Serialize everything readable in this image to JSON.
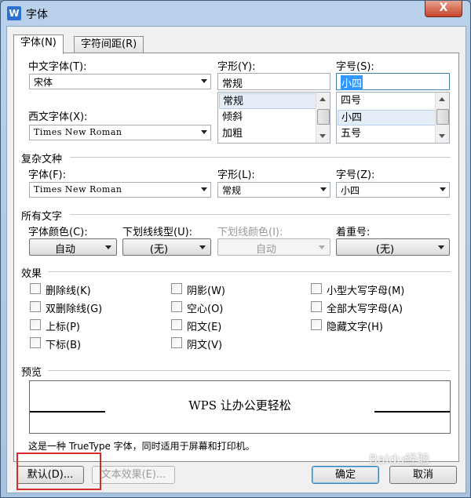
{
  "window": {
    "title": "字体",
    "app_icon": "W",
    "close_symbol": "X"
  },
  "tabs": [
    {
      "label": "字体(N)"
    },
    {
      "label": "字符间距(R)"
    }
  ],
  "chinese_font": {
    "label": "中文字体(T):",
    "value": "宋体"
  },
  "western_font": {
    "label": "西文字体(X):",
    "value": "Times New Roman"
  },
  "style": {
    "label": "字形(Y):",
    "value": "常规",
    "items": [
      "常规",
      "倾斜",
      "加粗"
    ],
    "selected": "常规"
  },
  "size": {
    "label": "字号(S):",
    "value": "小四",
    "items": [
      "四号",
      "小四",
      "五号"
    ],
    "selected": "小四"
  },
  "complex": {
    "section": "复杂文种",
    "font_label": "字体(F):",
    "font_value": "Times New Roman",
    "style_label": "字形(L):",
    "style_value": "常规",
    "size_label": "字号(Z):",
    "size_value": "小四"
  },
  "all_text": {
    "section": "所有文字",
    "color_label": "字体颜色(C):",
    "color_value": "自动",
    "underline_label": "下划线线型(U):",
    "underline_value": "(无)",
    "underline_color_label": "下划线颜色(I):",
    "underline_color_value": "自动",
    "emphasis_label": "着重号:",
    "emphasis_value": "(无)"
  },
  "effects": {
    "section": "效果",
    "items": [
      "删除线(K)",
      "双删除线(G)",
      "上标(P)",
      "下标(B)",
      "阴影(W)",
      "空心(O)",
      "阳文(E)",
      "阴文(V)",
      "小型大写字母(M)",
      "全部大写字母(A)",
      "隐藏文字(H)"
    ]
  },
  "preview": {
    "section": "预览",
    "sample": "WPS 让办公更轻松",
    "note": "这是一种 TrueType 字体，同时适用于屏幕和打印机。"
  },
  "buttons": {
    "default": "默认(D)...",
    "text_effects": "文本效果(E)...",
    "ok": "确定",
    "cancel": "取消"
  },
  "watermark": "Baidu经验",
  "colors": {
    "highlight": "#d62b2b",
    "selection": "#3399ff"
  }
}
